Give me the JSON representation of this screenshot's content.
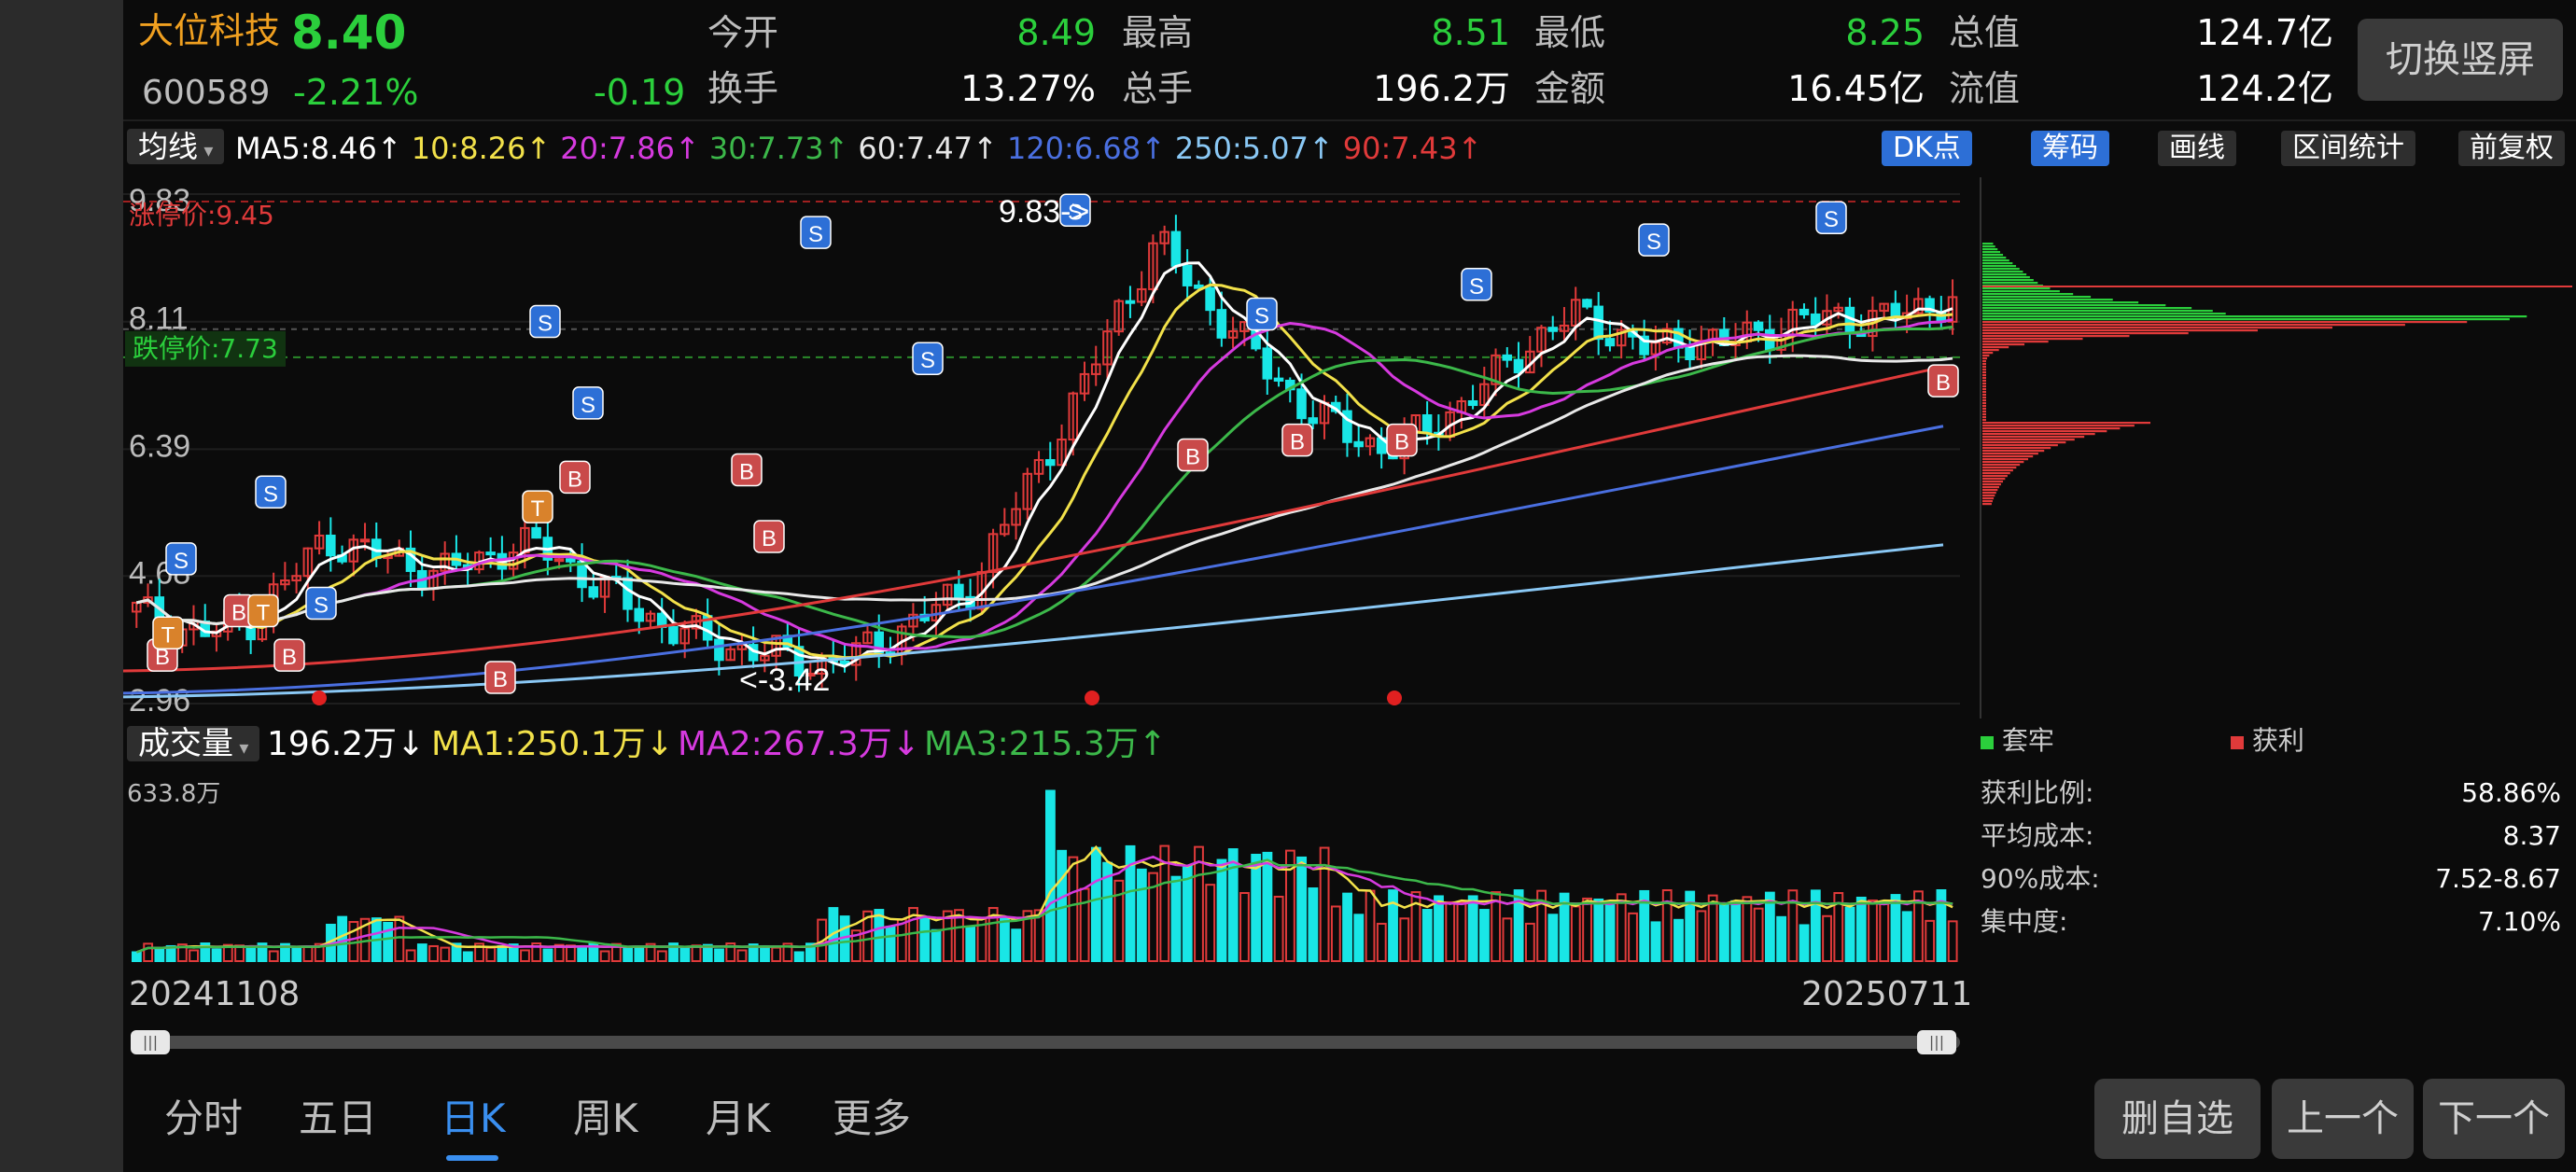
{
  "stock": {
    "name": "大位科技",
    "price": "8.40",
    "code": "600589",
    "change_pct": "-2.21%",
    "change": "-0.19"
  },
  "stats": [
    {
      "label": "今开",
      "value": "8.49"
    },
    {
      "label": "最高",
      "value": "8.51"
    },
    {
      "label": "最低",
      "value": "8.25"
    },
    {
      "label": "总值",
      "value": "124.7亿"
    },
    {
      "label": "换手",
      "value": "13.27%"
    },
    {
      "label": "总手",
      "value": "196.2万"
    },
    {
      "label": "金额",
      "value": "16.45亿"
    },
    {
      "label": "流值",
      "value": "124.2亿"
    }
  ],
  "switch_button": "切换竖屏",
  "ma_bar": {
    "dropdown": "均线",
    "items": [
      {
        "text": "MA5:8.46↑",
        "color": "#ffffff"
      },
      {
        "text": "10:8.26↑",
        "color": "#f2e14a"
      },
      {
        "text": "20:7.86↑",
        "color": "#d63adf"
      },
      {
        "text": "30:7.73↑",
        "color": "#3cb84a"
      },
      {
        "text": "60:7.47↑",
        "color": "#e8e8e8"
      },
      {
        "text": "120:6.68↑",
        "color": "#4a6fe0"
      },
      {
        "text": "250:5.07↑",
        "color": "#8ac8f5"
      },
      {
        "text": "90:7.43↑",
        "color": "#e03a3a"
      }
    ],
    "buttons": [
      "DK点",
      "筹码",
      "画线",
      "区间统计",
      "前复权"
    ]
  },
  "price_axis": [
    "9.83",
    "8.11",
    "6.39",
    "4.68",
    "2.96"
  ],
  "limit_up": "涨停价:9.45",
  "limit_down": "跌停价:7.73",
  "annotations": {
    "high": "9.83->",
    "low": "<-3.42"
  },
  "chip_legend": {
    "trapped": "套牢",
    "profit": "获利"
  },
  "chip_stats": [
    {
      "label": "获利比例:",
      "value": "58.86%"
    },
    {
      "label": "平均成本:",
      "value": "8.37"
    },
    {
      "label": "90%成本:",
      "value": "7.52-8.67"
    },
    {
      "label": "集中度:",
      "value": "7.10%"
    }
  ],
  "volume_bar": {
    "dropdown": "成交量",
    "current": "196.2万↓",
    "ma1": "MA1:250.1万↓",
    "ma2": "MA2:267.3万↓",
    "ma3": "MA3:215.3万↑",
    "max": "633.8万"
  },
  "dates": {
    "start": "20241108",
    "end": "20250711"
  },
  "tabs": [
    "分时",
    "五日",
    "日K",
    "周K",
    "月K",
    "更多"
  ],
  "active_tab": "日K",
  "bottom_buttons": [
    "删自选",
    "上一个",
    "下一个"
  ],
  "colors": {
    "up": "#e03a3a",
    "down": "#19e6e6",
    "accent": "#3a8ff0",
    "gain": "#2bcf3c",
    "name": "#f0a020"
  },
  "chart_data": {
    "type": "candlestick",
    "period": "daily",
    "x_range": [
      "20241108",
      "20250711"
    ],
    "ylim": [
      2.96,
      9.83
    ],
    "close_series": [
      4.2,
      4.0,
      3.9,
      4.1,
      4.6,
      5.2,
      5.0,
      4.9,
      4.7,
      4.9,
      5.1,
      5.0,
      4.6,
      4.3,
      4.0,
      3.8,
      3.7,
      3.6,
      3.5,
      3.6,
      3.9,
      4.2,
      4.5,
      5.4,
      6.3,
      7.2,
      8.3,
      9.2,
      8.5,
      8.0,
      7.4,
      6.9,
      6.6,
      6.4,
      6.6,
      7.0,
      7.4,
      7.9,
      8.2,
      8.0,
      7.7,
      7.9,
      7.8,
      8.0,
      8.1,
      8.2,
      8.1,
      8.3,
      8.4
    ],
    "volume_max": "633.8万"
  }
}
